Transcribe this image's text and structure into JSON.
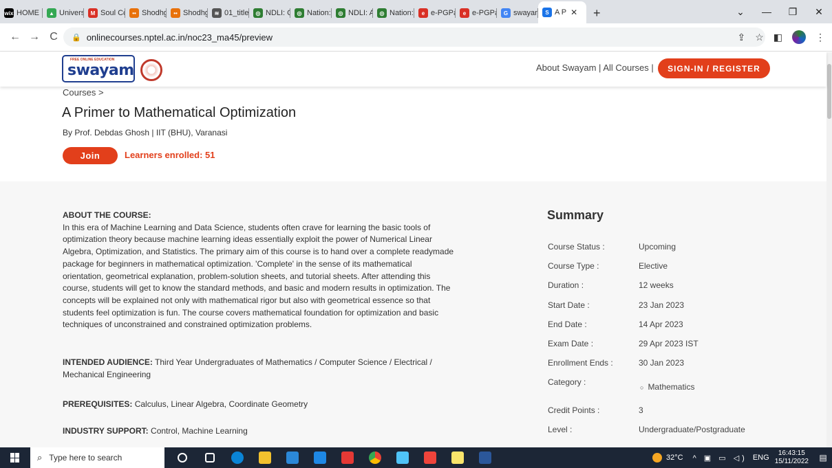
{
  "browser": {
    "tabs": [
      {
        "label": "HOME",
        "icon": "wix-icon",
        "color": "#000000",
        "glyph": "wix"
      },
      {
        "label": "Univers",
        "icon": "drive-icon",
        "color": "#34a853",
        "glyph": "▲"
      },
      {
        "label": "Soul Cc",
        "icon": "gmail-icon",
        "color": "#d93025",
        "glyph": "M"
      },
      {
        "label": "Shodhg",
        "icon": "shodhganga-icon",
        "color": "#e8710a",
        "glyph": "••"
      },
      {
        "label": "Shodhg",
        "icon": "shodhganga-icon",
        "color": "#e8710a",
        "glyph": "••"
      },
      {
        "label": "01_title",
        "icon": "document-icon",
        "color": "#555555",
        "glyph": "≋"
      },
      {
        "label": "NDLI: C",
        "icon": "ndli-icon",
        "color": "#2e7d32",
        "glyph": "◎"
      },
      {
        "label": "Nation:",
        "icon": "ndli-icon",
        "color": "#2e7d32",
        "glyph": "◎"
      },
      {
        "label": "NDLI: A",
        "icon": "ndli-icon",
        "color": "#2e7d32",
        "glyph": "◎"
      },
      {
        "label": "Nation:",
        "icon": "ndli-icon",
        "color": "#2e7d32",
        "glyph": "◎"
      },
      {
        "label": "e-PGPa",
        "icon": "epg-icon",
        "color": "#d93025",
        "glyph": "e"
      },
      {
        "label": "e-PGPa",
        "icon": "epg-icon",
        "color": "#d93025",
        "glyph": "e"
      },
      {
        "label": "swayar",
        "icon": "google-icon",
        "color": "#4285f4",
        "glyph": "G"
      },
      {
        "label": "A P",
        "icon": "swayam-icon",
        "color": "#1a73e8",
        "glyph": "S",
        "active": true
      }
    ],
    "new_tab": "+",
    "url": "onlinecourses.nptel.ac.in/noc23_ma45/preview"
  },
  "header": {
    "logo_text": "swayam",
    "logo_tagline": "FREE ONLINE EDUCATION",
    "nav_text": "About Swayam  |  All Courses  |",
    "signin_label": "SIGN-IN / REGISTER"
  },
  "course": {
    "breadcrumb": "Courses  >",
    "title": "A Primer to Mathematical Optimization",
    "byline": "By Prof. Debdas Ghosh   |   IIT (BHU), Varanasi",
    "join_label": "Join",
    "enrolled": "Learners enrolled: 51"
  },
  "about": {
    "heading": "ABOUT THE COURSE:",
    "lines": [
      "In this era of Machine Learning and Data Science, students often crave for learning the basic tools of",
      "optimization theory because machine learning ideas essentially exploit the power of Numerical Linear",
      "Algebra, Optimization, and Statistics. The primary aim of this course is to hand over a complete readymade",
      "package for beginners in mathematical optimization. 'Complete' in the sense of its mathematical",
      "orientation, geometrical explanation, problem-solution sheets, and tutorial sheets. After attending this",
      "course, students will get to know the standard methods, and basic and modern results in optimization. The",
      "concepts will be explained not only with mathematical rigor but also with geometrical essence so that",
      "students feel optimization is fun. The course covers mathematical foundation for optimization and basic",
      "techniques of unconstrained and constrained optimization problems."
    ],
    "audience_label": "INTENDED AUDIENCE:",
    "audience_line1": "Third Year Undergraduates of Mathematics / Computer Science / Electrical /",
    "audience_line2": "Mechanical Engineering",
    "prereq_label": "PREREQUISITES:",
    "prereq_value": "Calculus, Linear Algebra, Coordinate Geometry",
    "industry_label": "INDUSTRY SUPPORT:",
    "industry_value": "Control, Machine Learning"
  },
  "summary": {
    "title": "Summary",
    "course_status_label": "Course Status :",
    "course_status": "Upcoming",
    "course_type_label": "Course Type :",
    "course_type": "Elective",
    "duration_label": "Duration :",
    "duration": "12 weeks",
    "start_label": "Start Date :",
    "start": "23 Jan 2023",
    "end_label": "End Date :",
    "end": "14 Apr 2023",
    "exam_label": "Exam Date :",
    "exam": "29 Apr 2023 IST",
    "enroll_ends_label": "Enrollment Ends :",
    "enroll_ends": "30 Jan 2023",
    "category_label": "Category :",
    "category": "Mathematics",
    "credit_label": "Credit Points :",
    "credit": "3",
    "level_label": "Level :",
    "level": "Undergraduate/Postgraduate"
  },
  "taskbar": {
    "search_placeholder": "Type here to search",
    "temperature": "32°C",
    "language": "ENG",
    "time": "16:43:15",
    "date": "15/11/2022",
    "apps": [
      {
        "name": "task-view-icon",
        "color": "#ffffff"
      },
      {
        "name": "edge-icon",
        "color": "#0a84d6"
      },
      {
        "name": "file-explorer-icon",
        "color": "#f2c12e"
      },
      {
        "name": "store-icon",
        "color": "#2b88d8"
      },
      {
        "name": "mail-icon",
        "color": "#1e88e5"
      },
      {
        "name": "pinwheel-icon",
        "color": "#e53935"
      },
      {
        "name": "chrome-icon",
        "color": "#fbbc04"
      },
      {
        "name": "app-icon",
        "color": "#4fc3f7"
      },
      {
        "name": "anydesk-icon",
        "color": "#ef443b"
      },
      {
        "name": "notes-icon",
        "color": "#f9e46b"
      },
      {
        "name": "word-icon",
        "color": "#2b579a"
      }
    ]
  }
}
